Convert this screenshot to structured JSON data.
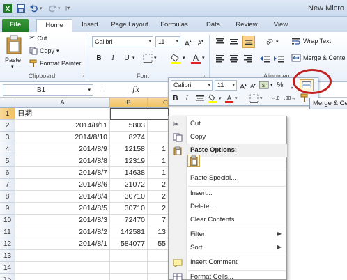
{
  "window": {
    "title": "New Micro"
  },
  "tabs": [
    "File",
    "Home",
    "Insert",
    "Page Layout",
    "Formulas",
    "Data",
    "Review",
    "View"
  ],
  "ribbon": {
    "clipboard": {
      "paste": "Paste",
      "cut": "Cut",
      "copy": "Copy",
      "format_painter": "Format Painter",
      "label": "Clipboard"
    },
    "font": {
      "font_name": "Calibri",
      "font_size": "11",
      "bold": "B",
      "italic": "I",
      "underline": "U",
      "label": "Font"
    },
    "alignment": {
      "wrap_text": "Wrap Text",
      "merge_center": "Merge & Cente",
      "label": "Alignmen"
    }
  },
  "formula_bar": {
    "name_box": "B1",
    "fx": "fx",
    "value": ""
  },
  "grid": {
    "columns": [
      "A",
      "B",
      "C"
    ],
    "rows": [
      {
        "num": "1",
        "a": "日期",
        "b": "",
        "c": ""
      },
      {
        "num": "2",
        "a": "2014/8/11",
        "b": "5803",
        "c": ""
      },
      {
        "num": "3",
        "a": "2014/8/10",
        "b": "8274",
        "c": ""
      },
      {
        "num": "4",
        "a": "2014/8/9",
        "b": "12158",
        "c": "1"
      },
      {
        "num": "5",
        "a": "2014/8/8",
        "b": "12319",
        "c": "1"
      },
      {
        "num": "6",
        "a": "2014/8/7",
        "b": "14638",
        "c": "1"
      },
      {
        "num": "7",
        "a": "2014/8/6",
        "b": "21072",
        "c": "2"
      },
      {
        "num": "8",
        "a": "2014/8/4",
        "b": "30710",
        "c": "2"
      },
      {
        "num": "9",
        "a": "2014/8/5",
        "b": "30710",
        "c": "2"
      },
      {
        "num": "10",
        "a": "2014/8/3",
        "b": "72470",
        "c": "7"
      },
      {
        "num": "11",
        "a": "2014/8/2",
        "b": "142581",
        "c": "13"
      },
      {
        "num": "12",
        "a": "2014/8/1",
        "b": "584077",
        "c": "55"
      },
      {
        "num": "13",
        "a": "",
        "b": "",
        "c": ""
      },
      {
        "num": "14",
        "a": "",
        "b": "",
        "c": ""
      },
      {
        "num": "15",
        "a": "",
        "b": "",
        "c": ""
      }
    ]
  },
  "mini_toolbar": {
    "font_name": "Calibri",
    "font_size": "11",
    "bold": "B",
    "italic": "I",
    "percent": "%"
  },
  "tooltip": "Merge & Ce",
  "context_menu": {
    "items": [
      {
        "label": "Cut",
        "icon": "scissors-icon"
      },
      {
        "label": "Copy",
        "icon": "copy-icon"
      },
      {
        "label": "Paste Options:",
        "icon": "paste-icon"
      },
      {
        "label": "Paste Special...",
        "icon": ""
      },
      {
        "label": "Insert...",
        "icon": ""
      },
      {
        "label": "Delete...",
        "icon": ""
      },
      {
        "label": "Clear Contents",
        "icon": ""
      },
      {
        "label": "Filter",
        "icon": ""
      },
      {
        "label": "Sort",
        "icon": ""
      },
      {
        "label": "Insert Comment",
        "icon": "comment-icon"
      },
      {
        "label": "Format Cells...",
        "icon": "format-cells-icon"
      }
    ]
  }
}
